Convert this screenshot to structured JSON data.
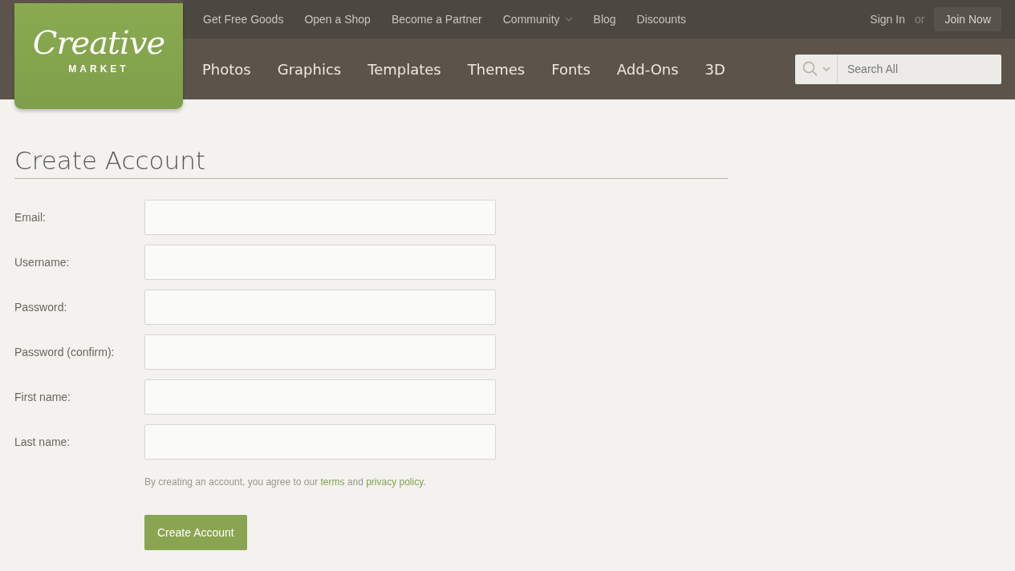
{
  "logo": {
    "script": "Creative",
    "caption": "MARKET"
  },
  "top_nav": [
    {
      "label": "Get Free Goods",
      "kind": "link"
    },
    {
      "label": "Open a Shop",
      "kind": "link"
    },
    {
      "label": "Become a Partner",
      "kind": "link"
    },
    {
      "label": "Community",
      "kind": "dropdown"
    },
    {
      "label": "Blog",
      "kind": "link"
    },
    {
      "label": "Discounts",
      "kind": "link"
    }
  ],
  "account": {
    "sign_in": "Sign In",
    "separator": "or",
    "join": "Join Now"
  },
  "main_nav": [
    "Photos",
    "Graphics",
    "Templates",
    "Themes",
    "Fonts",
    "Add-Ons",
    "3D"
  ],
  "search": {
    "placeholder": "Search All"
  },
  "page_title": "Create Account",
  "fields": [
    {
      "label": "Email:"
    },
    {
      "label": "Username:"
    },
    {
      "label": "Password:"
    },
    {
      "label": "Password (confirm):"
    },
    {
      "label": "First name:"
    },
    {
      "label": "Last name:"
    }
  ],
  "agreement": [
    {
      "kind": "text",
      "text": "By creating an account, you agree to our "
    },
    {
      "kind": "link",
      "text": "terms"
    },
    {
      "kind": "text",
      "text": " and "
    },
    {
      "kind": "link",
      "text": "privacy policy"
    },
    {
      "kind": "text",
      "text": "."
    }
  ],
  "submit": "Create Account"
}
